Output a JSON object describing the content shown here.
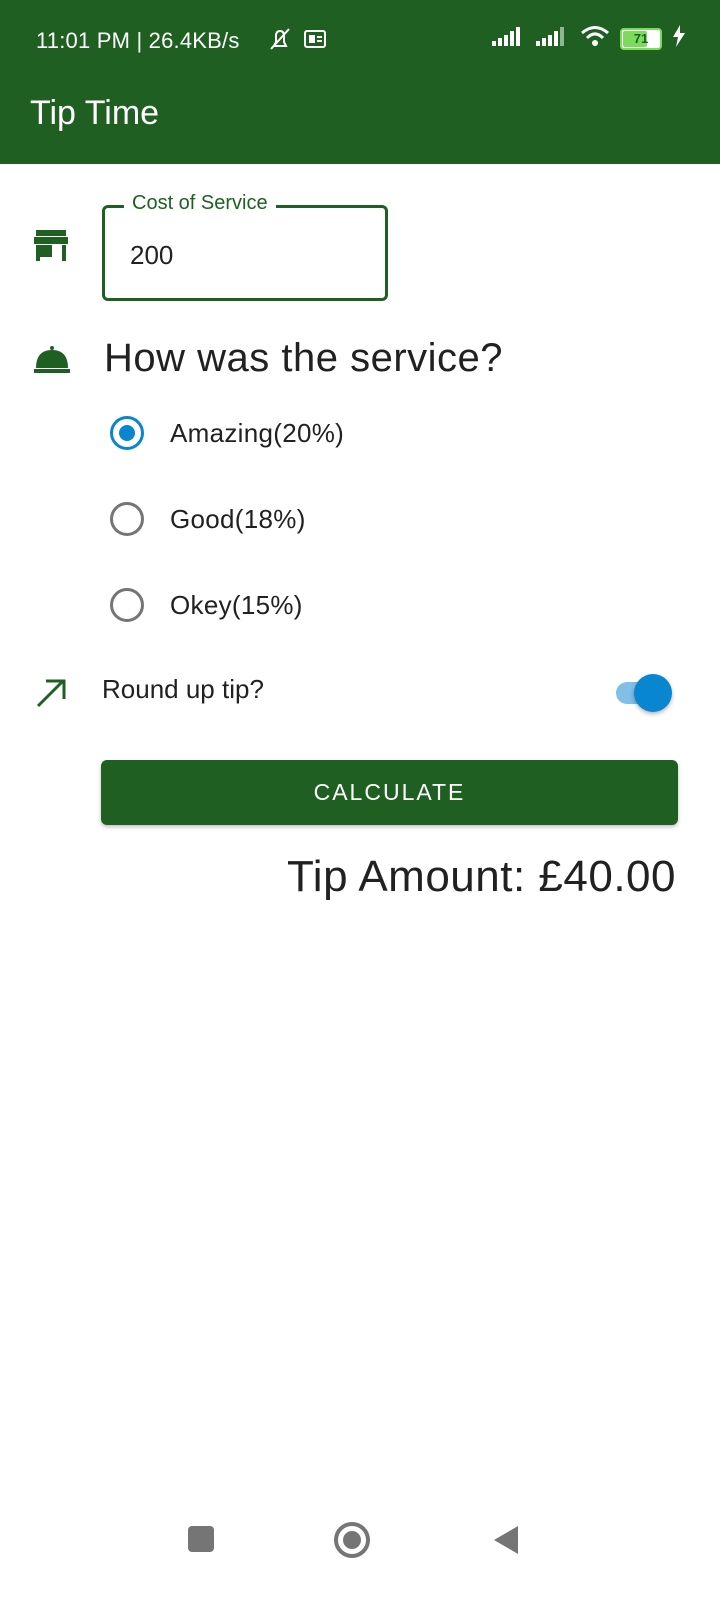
{
  "status_bar": {
    "time": "11:01 PM | 26.4KB/s",
    "battery": "71",
    "battery_percent": 71,
    "icons": [
      "mute-alarm-icon",
      "sim-icon",
      "signal-icon",
      "signal-icon-2",
      "wifi-icon",
      "battery-icon",
      "charging-icon"
    ]
  },
  "app_bar": {
    "title": "Tip Time"
  },
  "cost": {
    "label": "Cost of Service",
    "value": "200",
    "icon": "storefront-icon"
  },
  "service": {
    "question": "How was the service?",
    "icon": "room-service-icon",
    "options": [
      {
        "label": "Amazing(20%)",
        "selected": true
      },
      {
        "label": "Good(18%)",
        "selected": false
      },
      {
        "label": "Okey(15%)",
        "selected": false
      }
    ]
  },
  "round_up": {
    "label": "Round up tip?",
    "icon": "trending-up-icon",
    "enabled": true
  },
  "calculate_button": {
    "label": "CALCULATE"
  },
  "result": {
    "text": "Tip Amount: £40.00"
  },
  "colors": {
    "primary": "#1f5f22",
    "accent": "#0a85d0"
  },
  "nav": [
    "recents-button",
    "home-button",
    "back-button"
  ]
}
